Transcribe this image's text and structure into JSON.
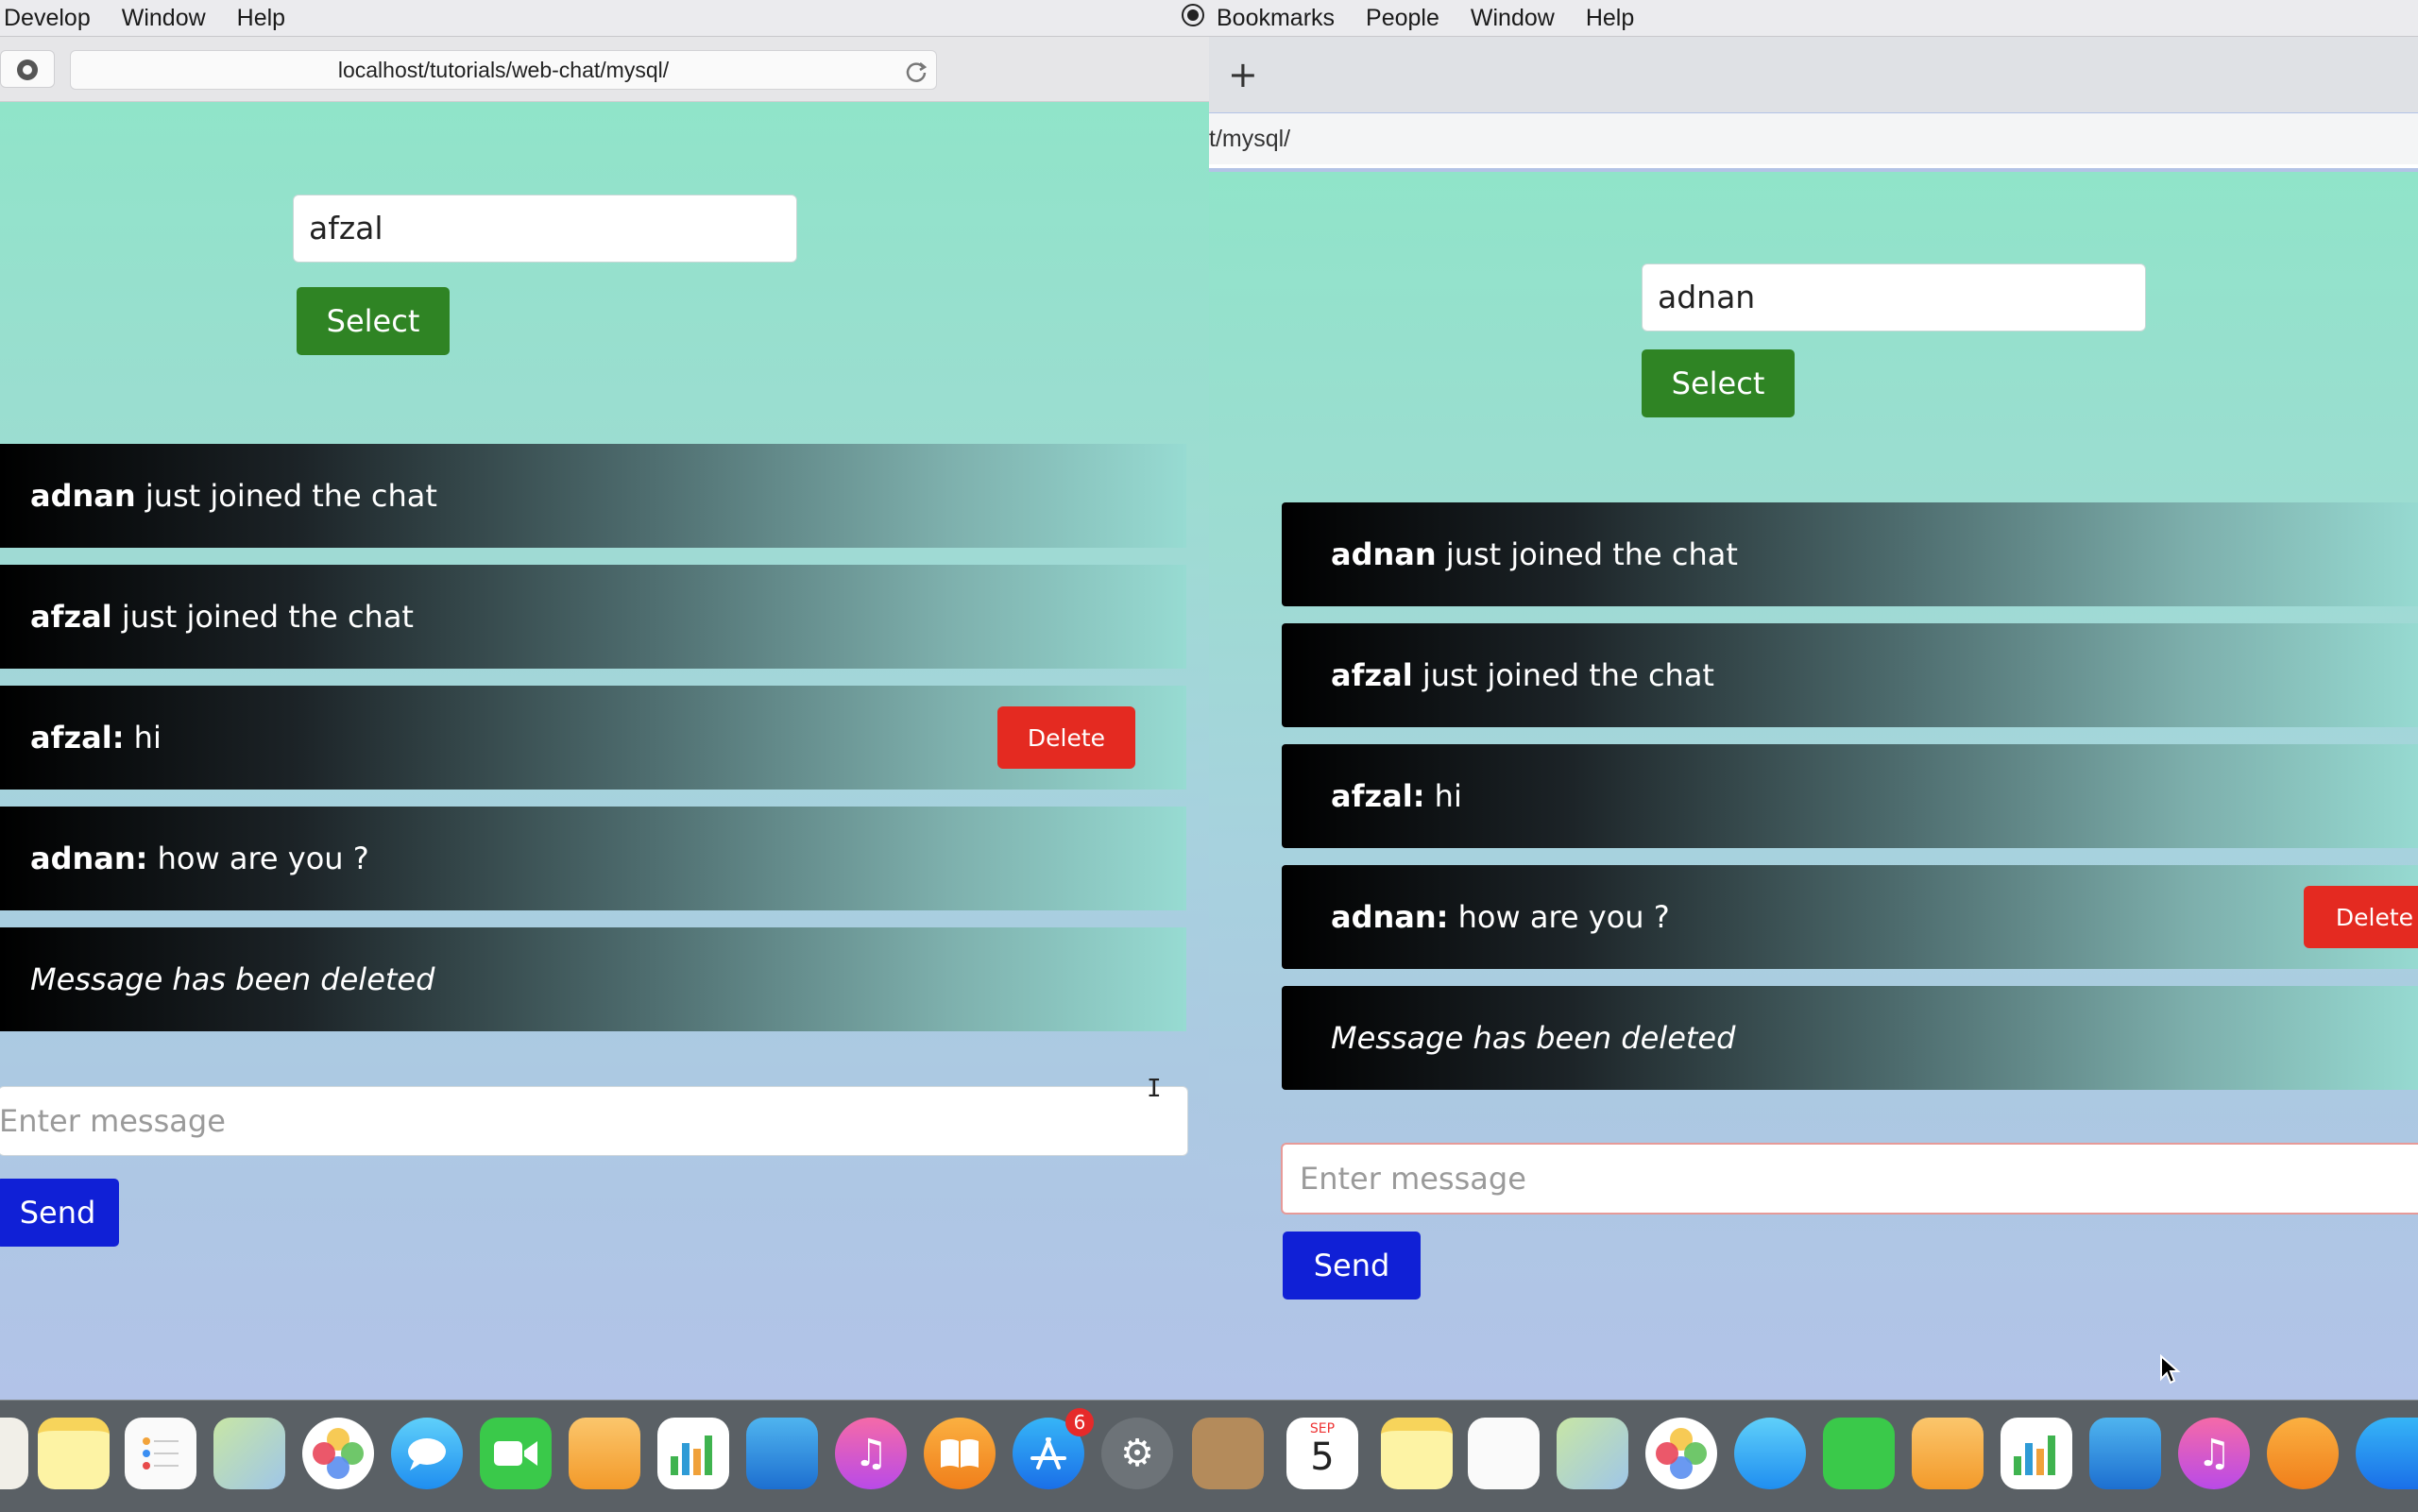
{
  "left": {
    "menu": [
      "Develop",
      "Window",
      "Help"
    ],
    "url": "localhost/tutorials/web-chat/mysql/",
    "name_value": "afzal",
    "select_label": "Select",
    "messages": [
      {
        "user": "adnan",
        "text": " just joined the chat"
      },
      {
        "user": "afzal",
        "text": " just joined the chat"
      },
      {
        "user": "afzal:",
        "text": " hi"
      },
      {
        "user": "adnan:",
        "text": " how are you ?"
      },
      {
        "user": "",
        "text": "Message has been deleted"
      }
    ],
    "delete_label": "Delete",
    "message_placeholder": "Enter message",
    "send_label": "Send"
  },
  "right": {
    "menu": [
      "Bookmarks",
      "People",
      "Window",
      "Help"
    ],
    "new_tab": "+",
    "url": "t/mysql/",
    "name_value": "adnan",
    "select_label": "Select",
    "messages": [
      {
        "user": "adnan",
        "text": " just joined the chat"
      },
      {
        "user": "afzal",
        "text": " just joined the chat"
      },
      {
        "user": "afzal:",
        "text": " hi"
      },
      {
        "user": "adnan:",
        "text": " how are you ?"
      },
      {
        "user": "",
        "text": "Message has been deleted"
      }
    ],
    "delete_label": "Delete",
    "message_placeholder": "Enter message",
    "send_label": "Send"
  },
  "dock": {
    "calendar_month": "SEP",
    "calendar_day": "5",
    "app_store_badge": "6"
  },
  "colors": {
    "select_button": "#2f8424",
    "send_button": "#1020d6",
    "delete_button": "#e42a21"
  }
}
